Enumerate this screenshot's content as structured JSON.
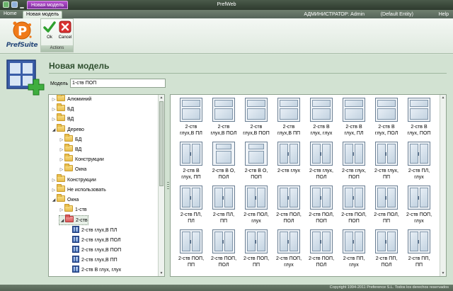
{
  "window": {
    "app_title": "PrefWeb",
    "context_tab": "Новая модель"
  },
  "menu": {
    "tabs": [
      {
        "label": "Home"
      },
      {
        "label": "Новая модель"
      }
    ],
    "user": "АДМИНИСТРАТОР: Admin",
    "entity": "(Default Entity)",
    "help": "Help"
  },
  "ribbon": {
    "logo_text": "PrefSuite",
    "actions": {
      "ok_label": "Ok",
      "cancel_label": "Cancel",
      "group_label": "Actions"
    }
  },
  "page": {
    "title": "Новая модель",
    "model_label": "Модель",
    "model_value": "1-ств ПОП"
  },
  "tree": [
    {
      "label": "Алюминий",
      "kind": "folder"
    },
    {
      "label": "БД",
      "kind": "folder"
    },
    {
      "label": "ВД",
      "kind": "folder"
    },
    {
      "label": "Дерево",
      "kind": "folder"
    },
    {
      "label": "БД",
      "kind": "folder"
    },
    {
      "label": "ВД",
      "kind": "folder"
    },
    {
      "label": "Конструкции",
      "kind": "folder"
    },
    {
      "label": "Окна",
      "kind": "folder"
    },
    {
      "label": "Конструкции",
      "kind": "folder"
    },
    {
      "label": "Не использовать",
      "kind": "folder"
    },
    {
      "label": "Окна",
      "kind": "folder"
    },
    {
      "label": "1-ств",
      "kind": "folder"
    },
    {
      "label": "2-ств",
      "kind": "folder-open"
    },
    {
      "label": "2-ств  глух,В ПЛ",
      "kind": "item"
    },
    {
      "label": "2-ств  глух,В ПОЛ",
      "kind": "item"
    },
    {
      "label": "2-ств  глух,В ПОП",
      "kind": "item"
    },
    {
      "label": "2-ств  глух,В ПП",
      "kind": "item"
    },
    {
      "label": "2-ств В глух, глух",
      "kind": "item"
    }
  ],
  "models": [
    {
      "l1": "2-ств",
      "l2": "глух,В ПЛ"
    },
    {
      "l1": "2-ств",
      "l2": "глух,В ПОЛ"
    },
    {
      "l1": "2-ств",
      "l2": "глух,В ПОП"
    },
    {
      "l1": "2-ств",
      "l2": "глух,В ПП"
    },
    {
      "l1": "2-ств В",
      "l2": "глух, глух"
    },
    {
      "l1": "2-ств В",
      "l2": "глух, ПЛ"
    },
    {
      "l1": "2-ств В",
      "l2": "глух, ПОЛ"
    },
    {
      "l1": "2-ств В",
      "l2": "глух, ПОП"
    },
    {
      "l1": "2-ств В",
      "l2": "глух, ПП"
    },
    {
      "l1": "2-ств В О,",
      "l2": "ПОЛ"
    },
    {
      "l1": "2-ств В О,",
      "l2": "ПОП"
    },
    {
      "l1": "2-ств глух",
      "l2": ""
    },
    {
      "l1": "2-ств глух,",
      "l2": "ПОЛ"
    },
    {
      "l1": "2-ств глух,",
      "l2": "ПОП"
    },
    {
      "l1": "2-ств глух,",
      "l2": "ПП"
    },
    {
      "l1": "2-ств ПЛ,",
      "l2": "глух"
    },
    {
      "l1": "2-ств ПЛ,",
      "l2": "ПЛ"
    },
    {
      "l1": "2-ств ПЛ,",
      "l2": "ПП"
    },
    {
      "l1": "2-ств ПОЛ,",
      "l2": "глух"
    },
    {
      "l1": "2-ств ПОЛ,",
      "l2": "ПОЛ"
    },
    {
      "l1": "2-ств ПОЛ,",
      "l2": "ПОП"
    },
    {
      "l1": "2-ств ПОЛ,",
      "l2": "ПОП"
    },
    {
      "l1": "2-ств ПОЛ,",
      "l2": "ПП"
    },
    {
      "l1": "2-ств ПОП,",
      "l2": "глух"
    },
    {
      "l1": "2-ств ПОП,",
      "l2": "ПП"
    },
    {
      "l1": "2-ств ПОП,",
      "l2": "ПОЛ"
    },
    {
      "l1": "2-ств ПОП,",
      "l2": "ПП"
    },
    {
      "l1": "2-ств ПОП,",
      "l2": "глух"
    },
    {
      "l1": "2-ств ПОП,",
      "l2": "ПОЛ"
    },
    {
      "l1": "2-ств ПП,",
      "l2": "глух"
    },
    {
      "l1": "2-ств ПП,",
      "l2": "ПОЛ"
    },
    {
      "l1": "2-ств ПП,",
      "l2": "ПП"
    }
  ],
  "status": {
    "copyright": "Copyright 1994-2011 Preference S.L. Todos los derechos reservados"
  }
}
